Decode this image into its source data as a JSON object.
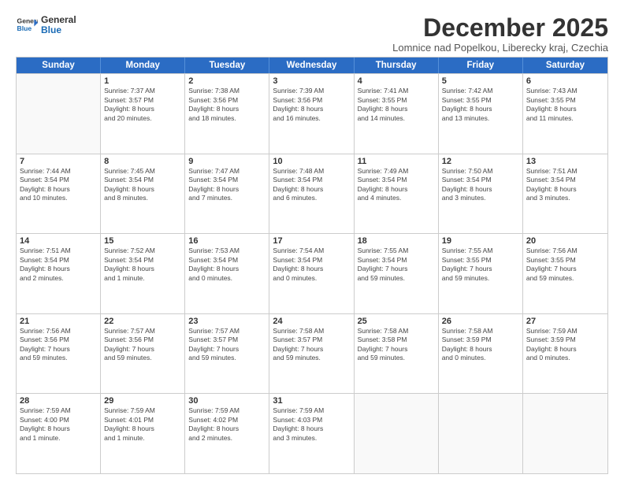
{
  "logo": {
    "line1": "General",
    "line2": "Blue"
  },
  "title": "December 2025",
  "subtitle": "Lomnice nad Popelkou, Liberecky kraj, Czechia",
  "header_days": [
    "Sunday",
    "Monday",
    "Tuesday",
    "Wednesday",
    "Thursday",
    "Friday",
    "Saturday"
  ],
  "weeks": [
    [
      {
        "day": "",
        "info": ""
      },
      {
        "day": "1",
        "info": "Sunrise: 7:37 AM\nSunset: 3:57 PM\nDaylight: 8 hours\nand 20 minutes."
      },
      {
        "day": "2",
        "info": "Sunrise: 7:38 AM\nSunset: 3:56 PM\nDaylight: 8 hours\nand 18 minutes."
      },
      {
        "day": "3",
        "info": "Sunrise: 7:39 AM\nSunset: 3:56 PM\nDaylight: 8 hours\nand 16 minutes."
      },
      {
        "day": "4",
        "info": "Sunrise: 7:41 AM\nSunset: 3:55 PM\nDaylight: 8 hours\nand 14 minutes."
      },
      {
        "day": "5",
        "info": "Sunrise: 7:42 AM\nSunset: 3:55 PM\nDaylight: 8 hours\nand 13 minutes."
      },
      {
        "day": "6",
        "info": "Sunrise: 7:43 AM\nSunset: 3:55 PM\nDaylight: 8 hours\nand 11 minutes."
      }
    ],
    [
      {
        "day": "7",
        "info": "Sunrise: 7:44 AM\nSunset: 3:54 PM\nDaylight: 8 hours\nand 10 minutes."
      },
      {
        "day": "8",
        "info": "Sunrise: 7:45 AM\nSunset: 3:54 PM\nDaylight: 8 hours\nand 8 minutes."
      },
      {
        "day": "9",
        "info": "Sunrise: 7:47 AM\nSunset: 3:54 PM\nDaylight: 8 hours\nand 7 minutes."
      },
      {
        "day": "10",
        "info": "Sunrise: 7:48 AM\nSunset: 3:54 PM\nDaylight: 8 hours\nand 6 minutes."
      },
      {
        "day": "11",
        "info": "Sunrise: 7:49 AM\nSunset: 3:54 PM\nDaylight: 8 hours\nand 4 minutes."
      },
      {
        "day": "12",
        "info": "Sunrise: 7:50 AM\nSunset: 3:54 PM\nDaylight: 8 hours\nand 3 minutes."
      },
      {
        "day": "13",
        "info": "Sunrise: 7:51 AM\nSunset: 3:54 PM\nDaylight: 8 hours\nand 3 minutes."
      }
    ],
    [
      {
        "day": "14",
        "info": "Sunrise: 7:51 AM\nSunset: 3:54 PM\nDaylight: 8 hours\nand 2 minutes."
      },
      {
        "day": "15",
        "info": "Sunrise: 7:52 AM\nSunset: 3:54 PM\nDaylight: 8 hours\nand 1 minute."
      },
      {
        "day": "16",
        "info": "Sunrise: 7:53 AM\nSunset: 3:54 PM\nDaylight: 8 hours\nand 0 minutes."
      },
      {
        "day": "17",
        "info": "Sunrise: 7:54 AM\nSunset: 3:54 PM\nDaylight: 8 hours\nand 0 minutes."
      },
      {
        "day": "18",
        "info": "Sunrise: 7:55 AM\nSunset: 3:54 PM\nDaylight: 7 hours\nand 59 minutes."
      },
      {
        "day": "19",
        "info": "Sunrise: 7:55 AM\nSunset: 3:55 PM\nDaylight: 7 hours\nand 59 minutes."
      },
      {
        "day": "20",
        "info": "Sunrise: 7:56 AM\nSunset: 3:55 PM\nDaylight: 7 hours\nand 59 minutes."
      }
    ],
    [
      {
        "day": "21",
        "info": "Sunrise: 7:56 AM\nSunset: 3:56 PM\nDaylight: 7 hours\nand 59 minutes."
      },
      {
        "day": "22",
        "info": "Sunrise: 7:57 AM\nSunset: 3:56 PM\nDaylight: 7 hours\nand 59 minutes."
      },
      {
        "day": "23",
        "info": "Sunrise: 7:57 AM\nSunset: 3:57 PM\nDaylight: 7 hours\nand 59 minutes."
      },
      {
        "day": "24",
        "info": "Sunrise: 7:58 AM\nSunset: 3:57 PM\nDaylight: 7 hours\nand 59 minutes."
      },
      {
        "day": "25",
        "info": "Sunrise: 7:58 AM\nSunset: 3:58 PM\nDaylight: 7 hours\nand 59 minutes."
      },
      {
        "day": "26",
        "info": "Sunrise: 7:58 AM\nSunset: 3:59 PM\nDaylight: 8 hours\nand 0 minutes."
      },
      {
        "day": "27",
        "info": "Sunrise: 7:59 AM\nSunset: 3:59 PM\nDaylight: 8 hours\nand 0 minutes."
      }
    ],
    [
      {
        "day": "28",
        "info": "Sunrise: 7:59 AM\nSunset: 4:00 PM\nDaylight: 8 hours\nand 1 minute."
      },
      {
        "day": "29",
        "info": "Sunrise: 7:59 AM\nSunset: 4:01 PM\nDaylight: 8 hours\nand 1 minute."
      },
      {
        "day": "30",
        "info": "Sunrise: 7:59 AM\nSunset: 4:02 PM\nDaylight: 8 hours\nand 2 minutes."
      },
      {
        "day": "31",
        "info": "Sunrise: 7:59 AM\nSunset: 4:03 PM\nDaylight: 8 hours\nand 3 minutes."
      },
      {
        "day": "",
        "info": ""
      },
      {
        "day": "",
        "info": ""
      },
      {
        "day": "",
        "info": ""
      }
    ]
  ]
}
